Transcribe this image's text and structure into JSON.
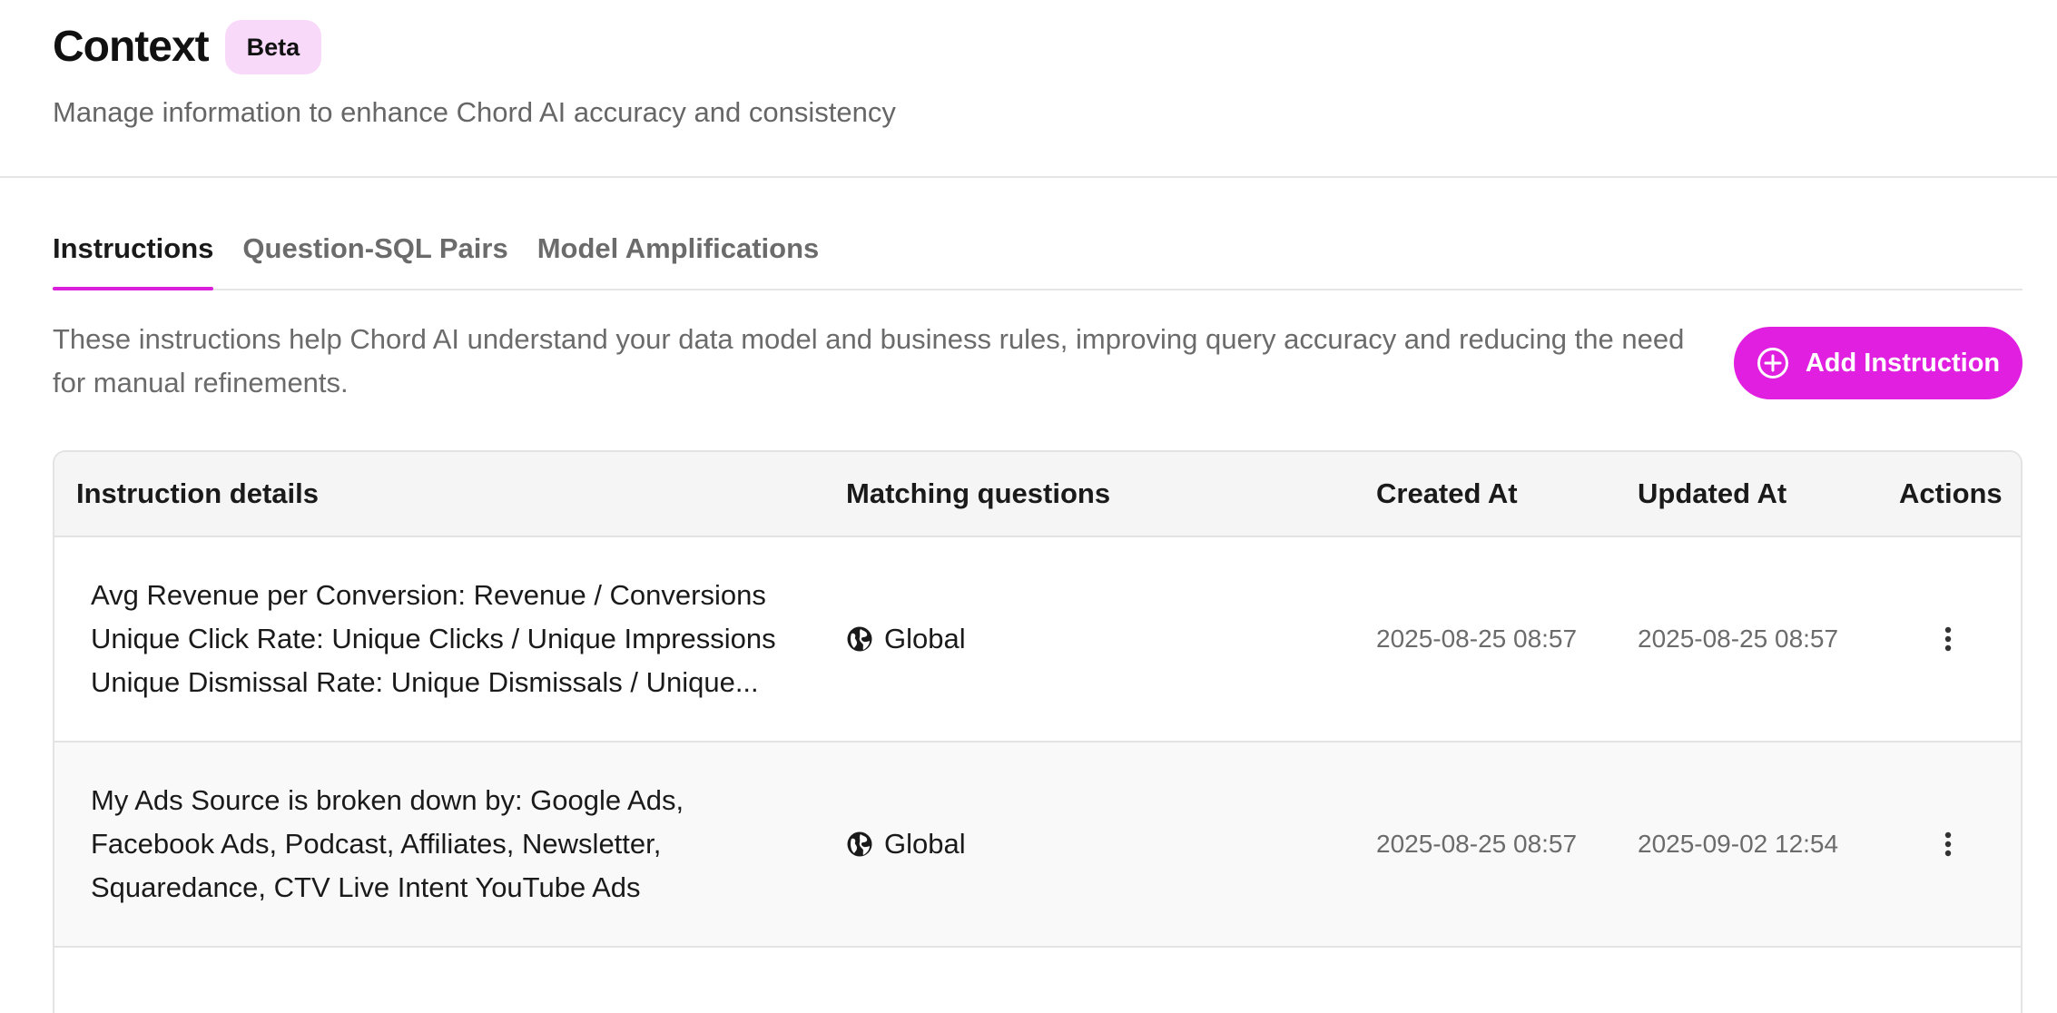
{
  "header": {
    "title": "Context",
    "badge": "Beta",
    "subtitle": "Manage information to enhance Chord AI accuracy and consistency"
  },
  "tabs": [
    {
      "label": "Instructions",
      "active": true
    },
    {
      "label": "Question-SQL Pairs",
      "active": false
    },
    {
      "label": "Model Amplifications",
      "active": false
    }
  ],
  "description": "These instructions help Chord AI understand your data model and business rules, improving query accuracy and reducing the need for manual refinements.",
  "add_button": {
    "label": "Add Instruction",
    "icon": "plus-circle-icon"
  },
  "table": {
    "columns": [
      "Instruction details",
      "Matching questions",
      "Created At",
      "Updated At",
      "Actions"
    ],
    "rows": [
      {
        "details": [
          "Avg Revenue per Conversion: Revenue / Conversions",
          "Unique Click Rate: Unique Clicks / Unique Impressions",
          "Unique Dismissal Rate: Unique Dismissals / Unique..."
        ],
        "matching": "Global",
        "created": "2025-08-25 08:57",
        "updated": "2025-08-25 08:57"
      },
      {
        "details": [
          "My Ads Source is broken down by: Google Ads,",
          "Facebook Ads, Podcast, Affiliates, Newsletter,",
          "Squaredance, CTV Live Intent YouTube Ads"
        ],
        "matching": "Global",
        "created": "2025-08-25 08:57",
        "updated": "2025-09-02 12:54"
      }
    ]
  },
  "colors": {
    "accent": "#e01fe0",
    "badge_bg": "#f9d9fa",
    "tab_underline": "#d91fd9"
  }
}
